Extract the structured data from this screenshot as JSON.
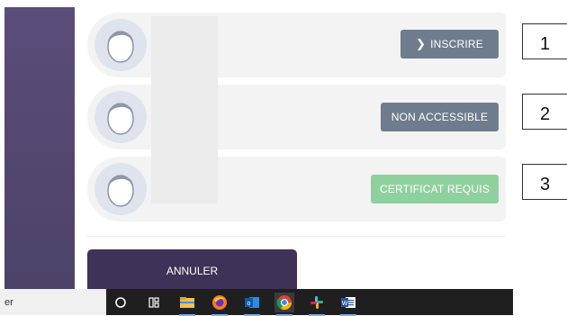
{
  "courses": [
    {
      "status_label": "INSCRIRE",
      "status_icon": "chevron-right-icon"
    },
    {
      "status_label": "NON ACCESSIBLE"
    },
    {
      "status_label": "CERTIFICAT REQUIS"
    }
  ],
  "cancel_label": "ANNULER",
  "annotations": [
    "1",
    "2",
    "3"
  ],
  "taskbar": {
    "search_text": "er",
    "icons": [
      "cortana-circle-icon",
      "task-view-icon",
      "file-explorer-icon",
      "firefox-icon",
      "outlook-icon",
      "chrome-icon",
      "slack-icon",
      "word-icon"
    ]
  },
  "colors": {
    "sidebar": "#5a4d7a",
    "status_button": "#6f7c8e",
    "certificate_button": "#8fd19e",
    "cancel_button": "#3f3259"
  }
}
